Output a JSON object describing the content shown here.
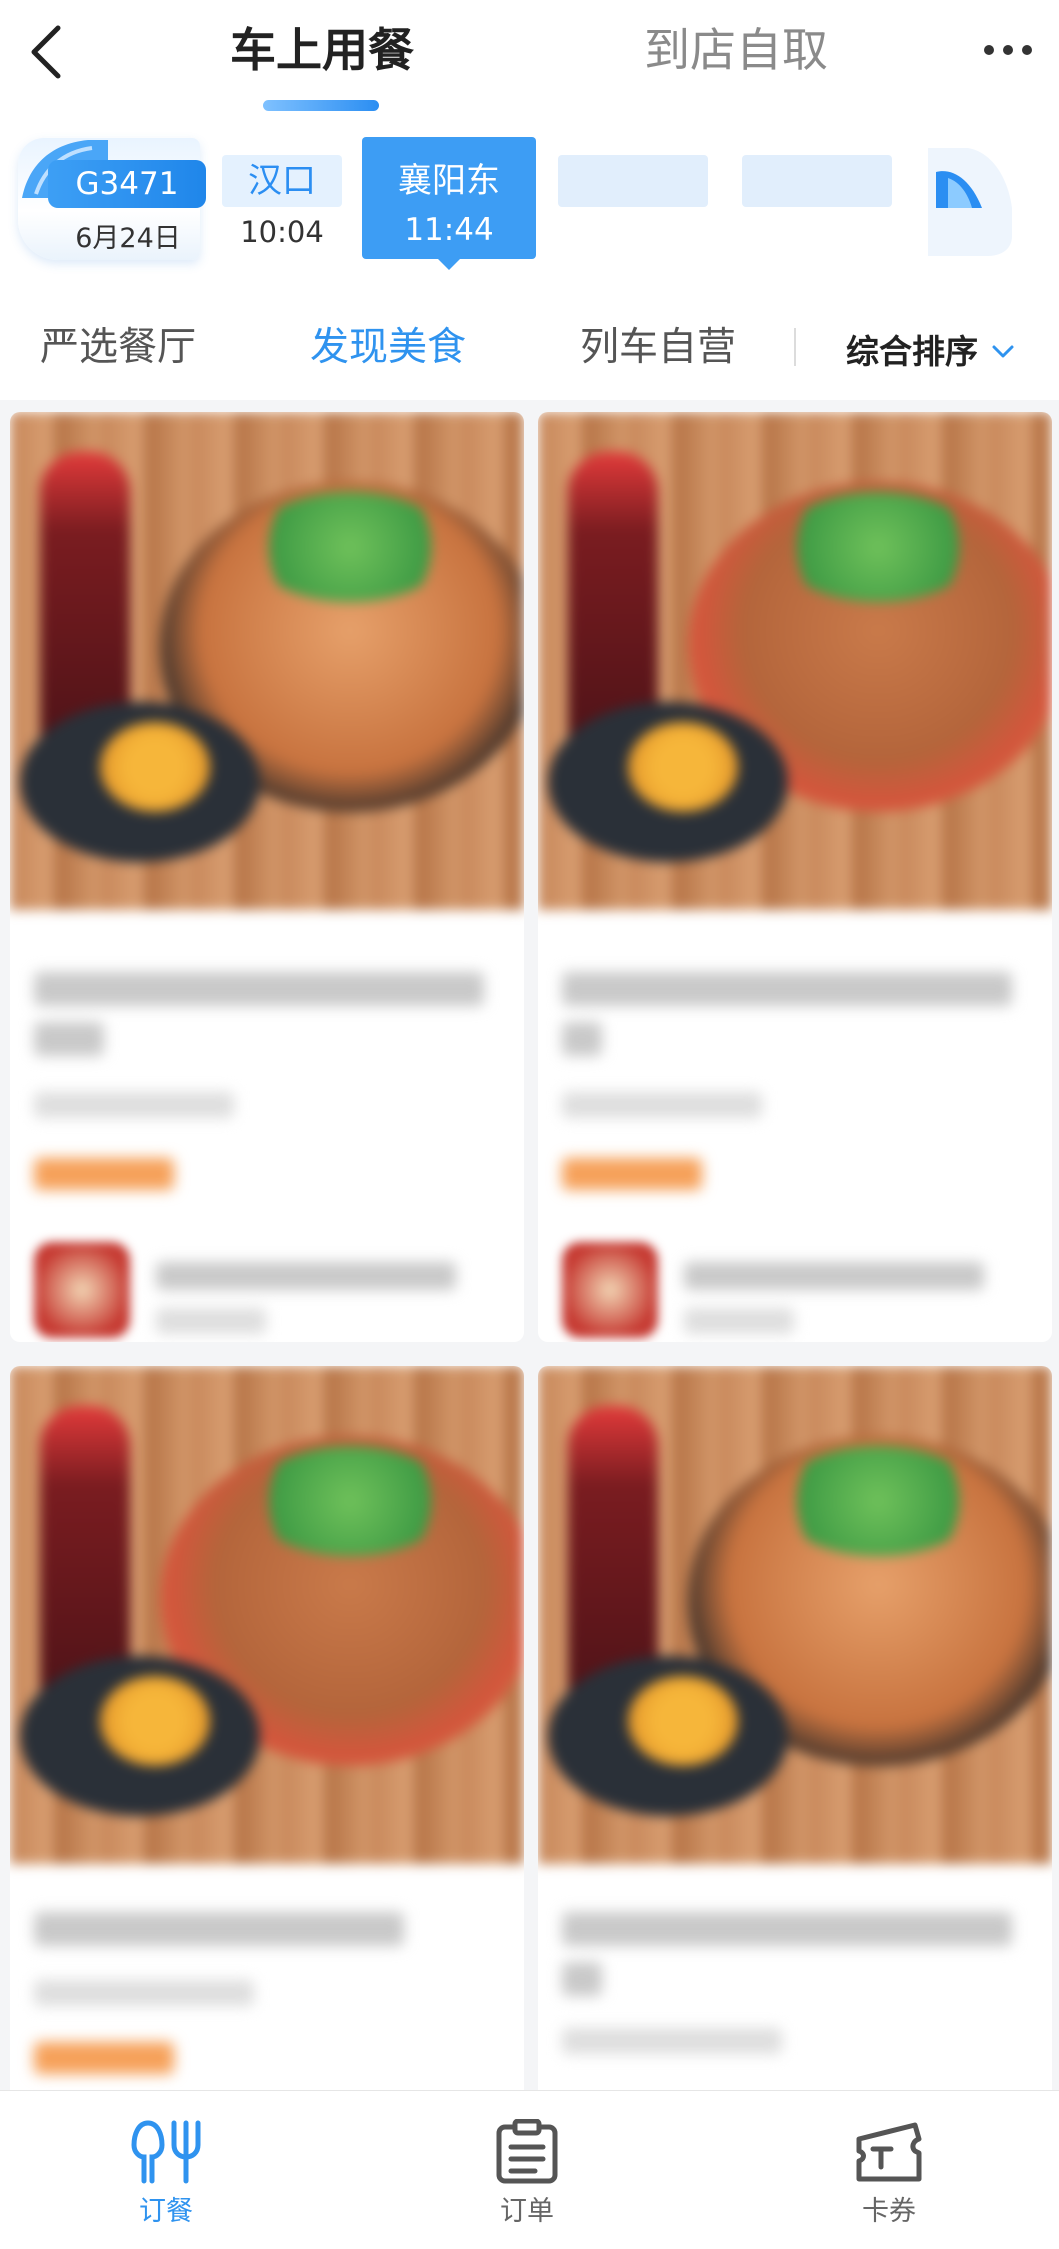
{
  "header": {
    "tabs": [
      {
        "label": "车上用餐",
        "active": true
      },
      {
        "label": "到店自取",
        "active": false
      }
    ],
    "back_icon": "back-chevron-icon",
    "more_icon": "more-dots-icon"
  },
  "train": {
    "code": "G3471",
    "date": "6月24日",
    "stops": [
      {
        "name": "汉口",
        "time": "10:04",
        "selected": false
      },
      {
        "name": "襄阳东",
        "time": "11:44",
        "selected": true
      }
    ]
  },
  "categories": [
    {
      "label": "严选餐厅",
      "active": false
    },
    {
      "label": "发现美食",
      "active": true
    },
    {
      "label": "列车自营",
      "active": false
    }
  ],
  "sort": {
    "label": "综合排序",
    "icon": "chevron-down-icon"
  },
  "bottom_nav": [
    {
      "label": "订餐",
      "icon": "utensils-icon",
      "active": true
    },
    {
      "label": "订单",
      "icon": "clipboard-icon",
      "active": false
    },
    {
      "label": "卡券",
      "icon": "ticket-icon",
      "active": false
    }
  ],
  "colors": {
    "accent": "#2f93ef",
    "selected_stop": "#3d9df4",
    "inactive_text": "#8a8a8a"
  }
}
